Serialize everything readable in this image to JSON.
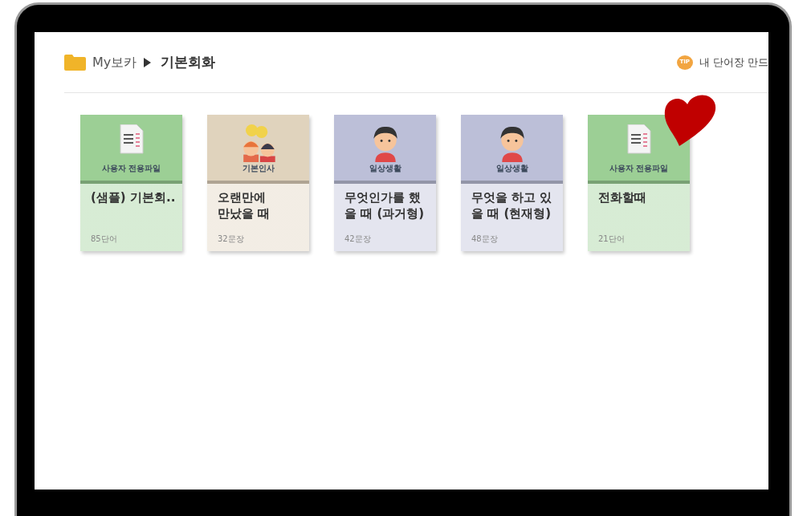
{
  "breadcrumb": {
    "root": "My보카",
    "current": "기본회화"
  },
  "tip": {
    "badge": "TIP",
    "label": "내 단어장 만드"
  },
  "cards": [
    {
      "kind": "document",
      "color": "#9ccf95",
      "category": "사용자 전용파일",
      "title_lines": [
        "(샘플) 기본회.."
      ],
      "count": "85단어"
    },
    {
      "kind": "two-people",
      "color": "#e0d3bd",
      "category": "기본인사",
      "title_lines": [
        "오랜만에",
        "만났을 때"
      ],
      "count": "32문장"
    },
    {
      "kind": "boy",
      "color": "#bcbfd8",
      "category": "일상생활",
      "title_lines": [
        "무엇인가를 했",
        "을 때 (과거형)"
      ],
      "count": "42문장"
    },
    {
      "kind": "boy",
      "color": "#bcbfd8",
      "category": "일상생활",
      "title_lines": [
        "무엇을 하고 있",
        "을 때 (현재형)"
      ],
      "count": "48문장"
    },
    {
      "kind": "document",
      "color": "#9ccf95",
      "category": "사용자 전용파일",
      "title_lines": [
        "전화할때"
      ],
      "count": "21단어"
    }
  ]
}
